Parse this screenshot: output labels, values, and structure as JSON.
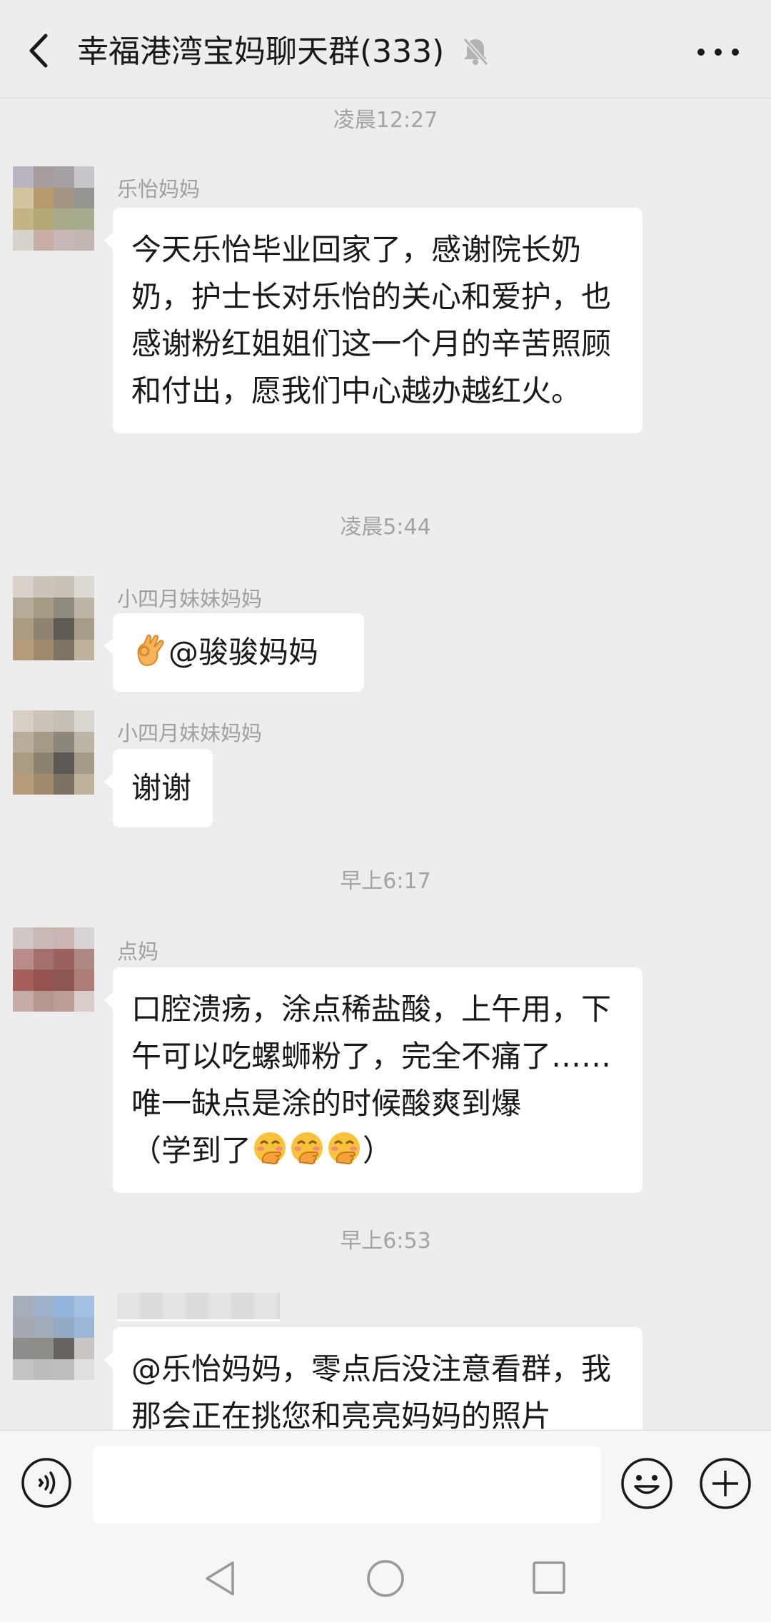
{
  "header": {
    "title": "幸福港湾宝妈聊天群(333)",
    "icons": [
      "back-arrow-icon",
      "mute-bell-icon",
      "more-icon"
    ]
  },
  "messages": [
    {
      "time": "凌晨12:27",
      "sender": "乐怡妈妈",
      "text": "今天乐怡毕业回家了，感谢院长奶奶，护士长对乐怡的关心和爱护，也感谢粉红姐姐们这一个月的辛苦照顾和付出，愿我们中心越办越红火。"
    },
    {
      "time": "凌晨5:44",
      "sender": "小四月妹妹妈妈",
      "emoji": "ok-hand-emoji",
      "text": "@骏骏妈妈"
    },
    {
      "sender": "小四月妹妹妈妈",
      "text": "谢谢"
    },
    {
      "time": "早上6:17",
      "sender": "点妈",
      "text_main": "口腔溃疡，涂点稀盐酸，上午用，下午可以吃螺蛳粉了，完全不痛了……唯一缺点是涂的时候酸爽到爆",
      "text_tail_open": "（学到了",
      "text_tail_close": "）",
      "emojis": [
        "hand-over-mouth-emoji",
        "hand-over-mouth-emoji",
        "hand-over-mouth-emoji"
      ]
    },
    {
      "time": "早上6:53",
      "text": "@乐怡妈妈，零点后没注意看群，我那会正在挑您和亮亮妈妈的照片"
    }
  ],
  "input": {
    "value": "",
    "placeholder": ""
  },
  "colors": {
    "background": "#ededed",
    "bubble": "#ffffff",
    "timestamp": "#a3a3a3",
    "sender": "#a0a0a0",
    "text": "#191919"
  }
}
